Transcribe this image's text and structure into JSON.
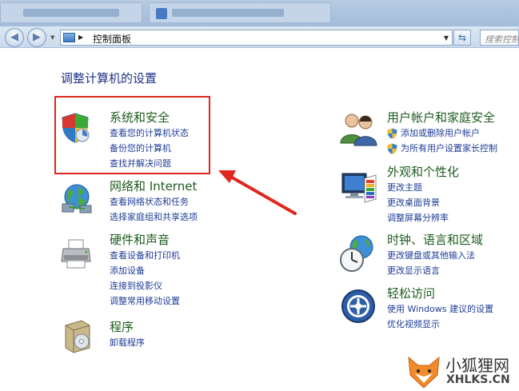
{
  "window": {
    "blurred_tabs": [
      "",
      ""
    ]
  },
  "address_bar": {
    "path": "控制面板",
    "search_placeholder": "搜索控制面"
  },
  "heading": "调整计算机的设置",
  "categories": [
    {
      "title": "系统和安全",
      "icon": "shield-icon",
      "links": [
        "查看您的计算机状态",
        "备份您的计算机",
        "查找并解决问题"
      ]
    },
    {
      "title": "网络和 Internet",
      "icon": "network-globe-icon",
      "links": [
        "查看网络状态和任务",
        "选择家庭组和共享选项"
      ]
    },
    {
      "title": "硬件和声音",
      "icon": "printer-icon",
      "links": [
        "查看设备和打印机",
        "添加设备",
        "连接到投影仪",
        "调整常用移动设置"
      ]
    },
    {
      "title": "程序",
      "icon": "programs-box-icon",
      "links": [
        "卸载程序"
      ]
    },
    {
      "title": "用户帐户和家庭安全",
      "icon": "users-icon",
      "links": [
        "添加或删除用户帐户",
        "为所有用户设置家长控制"
      ]
    },
    {
      "title": "外观和个性化",
      "icon": "monitor-palette-icon",
      "links": [
        "更改主题",
        "更改桌面背景",
        "调整屏幕分辨率"
      ]
    },
    {
      "title": "时钟、语言和区域",
      "icon": "clock-globe-icon",
      "links": [
        "更改键盘或其他输入法",
        "更改显示语言"
      ]
    },
    {
      "title": "轻松访问",
      "icon": "ease-of-access-icon",
      "links": [
        "使用 Windows 建议的设置",
        "优化视频显示"
      ]
    }
  ],
  "watermark": {
    "cn": "小狐狸网",
    "en": "XHLKS.CN"
  },
  "colors": {
    "title_green": "#1e5c1e",
    "link_blue": "#1e3c96",
    "highlight_red": "#e0261e",
    "chrome_blue": "#b7cbe2"
  }
}
